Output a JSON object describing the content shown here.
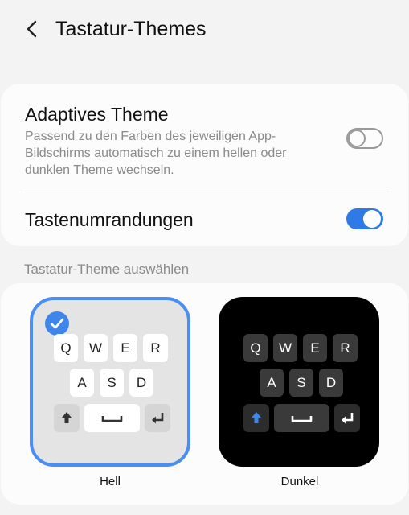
{
  "header": {
    "title": "Tastatur-Themes",
    "back_icon": "chevron-left-icon"
  },
  "adaptive": {
    "title": "Adaptives Theme",
    "description": "Passend zu den Farben des jeweiligen App-Bildschirms automatisch zu einem hellen oder dunklen Theme wechseln.",
    "enabled": false
  },
  "key_borders": {
    "title": "Tastenumrandungen",
    "enabled": true
  },
  "theme_section": {
    "label": "Tastatur-Theme auswählen"
  },
  "themes": [
    {
      "name": "Hell",
      "selected": true
    },
    {
      "name": "Dunkel",
      "selected": false
    }
  ],
  "keyboard_preview": {
    "row1": [
      "Q",
      "W",
      "E",
      "R"
    ],
    "row2": [
      "A",
      "S",
      "D"
    ]
  },
  "colors": {
    "accent": "#2f7ae5",
    "selection_border": "#4a8ef2",
    "shift_active_dark": "#3f86ec"
  }
}
